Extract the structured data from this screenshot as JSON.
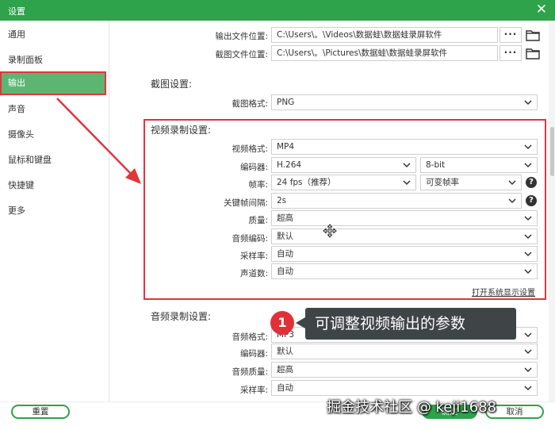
{
  "window": {
    "title": "设置",
    "close_symbol": "✕"
  },
  "sidebar": {
    "items": [
      {
        "label": "通用"
      },
      {
        "label": "录制面板"
      },
      {
        "label": "输出"
      },
      {
        "label": "声音"
      },
      {
        "label": "摄像头"
      },
      {
        "label": "鼠标和键盘"
      },
      {
        "label": "快捷键"
      },
      {
        "label": "更多"
      }
    ],
    "active_index": 2
  },
  "output": {
    "file_location_label": "输出文件位置:",
    "file_location_value": "C:\\Users\\。\\Videos\\数据蛙\\数据蛙录屏软件",
    "screenshot_location_label": "截图文件位置:",
    "screenshot_location_value": "C:\\Users\\。\\Pictures\\数据蛙\\数据蛙录屏软件",
    "browse_label": "···"
  },
  "screenshot_settings": {
    "title": "截图设置:",
    "format_label": "截图格式:",
    "format_value": "PNG"
  },
  "video_settings": {
    "title": "视频录制设置:",
    "format_label": "视频格式:",
    "format_value": "MP4",
    "encoder_label": "编码器:",
    "encoder_value": "H.264",
    "bitdepth_value": "8-bit",
    "framerate_label": "帧率:",
    "framerate_value": "24 fps（推荐）",
    "framerate_mode_value": "可变帧率",
    "keyframe_label": "关键帧间隔:",
    "keyframe_value": "2s",
    "quality_label": "质量:",
    "quality_value": "超高",
    "audio_codec_label": "音频编码:",
    "audio_codec_value": "默认",
    "sample_rate_label": "采样率:",
    "sample_rate_value": "自动",
    "channels_label": "声道数:",
    "channels_value": "自动",
    "display_settings_link": "打开系统显示设置",
    "help_symbol": "?"
  },
  "audio_settings": {
    "title": "音频录制设置:",
    "format_label": "音频格式:",
    "format_value": "MP3",
    "encoder_label": "编码器:",
    "encoder_value": "默认",
    "quality_label": "音频质量:",
    "quality_value": "超高",
    "sample_rate_label": "采样率:",
    "sample_rate_value": "自动"
  },
  "footer": {
    "reset_label": "重置",
    "ok_label": "确定",
    "cancel_label": "取消"
  },
  "annotation": {
    "number": "1",
    "text": "可调整视频输出的参数"
  },
  "watermark": "掘金技术社区 @ keji1688",
  "colors": {
    "accent": "#2fa24c",
    "active_item": "#5cb672",
    "highlight": "#e0363c",
    "callout_bg": "#3f4447"
  }
}
